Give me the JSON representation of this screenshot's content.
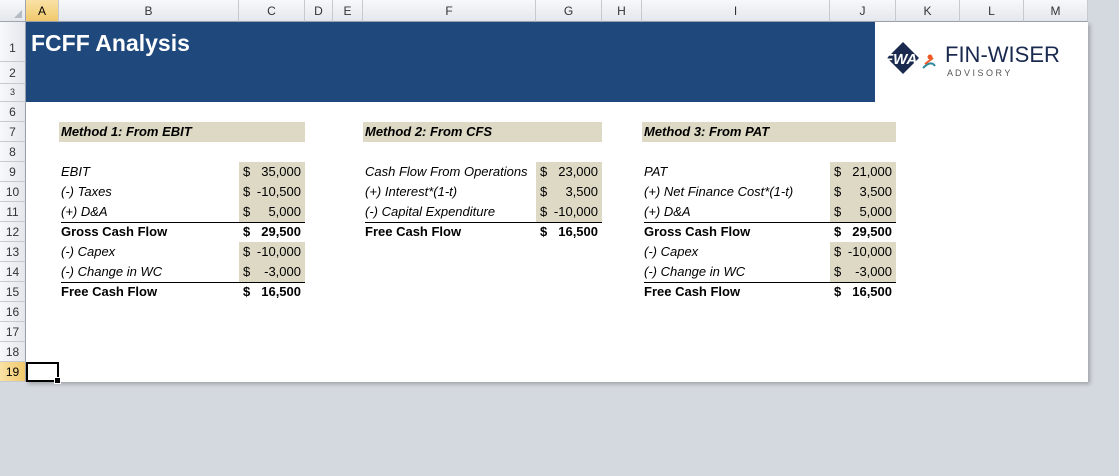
{
  "columns": [
    "A",
    "B",
    "C",
    "D",
    "E",
    "F",
    "G",
    "H",
    "I",
    "J",
    "K",
    "L",
    "M"
  ],
  "rows": [
    "1",
    "2",
    "3",
    "6",
    "7",
    "8",
    "9",
    "10",
    "11",
    "12",
    "13",
    "14",
    "15",
    "16",
    "17",
    "18",
    "19"
  ],
  "title": "FCFF Analysis",
  "logo": {
    "initials": "FWA",
    "name": "FIN-WISER",
    "sub": "A D V I S O R Y",
    "colors": {
      "navy": "#1a2a4f",
      "orange": "#f05a28",
      "teal": "#2b8a9a"
    }
  },
  "colors": {
    "banner": "#1f497d",
    "cell_fill": "#ddd9c4"
  },
  "method1": {
    "header": "Method 1: From EBIT",
    "rows": [
      {
        "label": "EBIT",
        "sym": "$",
        "value": "35,000"
      },
      {
        "label": " (-) Taxes",
        "sym": "$",
        "value": "-10,500"
      },
      {
        "label": " (+) D&A",
        "sym": "$",
        "value": "5,000"
      },
      {
        "label": "Gross Cash Flow",
        "sym": "$",
        "value": "29,500"
      },
      {
        "label": " (-) Capex",
        "sym": "$",
        "value": "-10,000"
      },
      {
        "label": " (-) Change in WC",
        "sym": "$",
        "value": "-3,000"
      },
      {
        "label": "Free Cash Flow",
        "sym": "$",
        "value": "16,500"
      }
    ]
  },
  "method2": {
    "header": "Method 2: From CFS",
    "rows": [
      {
        "label": "Cash Flow From Operations",
        "sym": "$",
        "value": "23,000"
      },
      {
        "label": " (+) Interest*(1-t)",
        "sym": "$",
        "value": "3,500"
      },
      {
        "label": " (-) Capital Expenditure",
        "sym": "$",
        "value": "-10,000"
      },
      {
        "label": "Free Cash Flow",
        "sym": "$",
        "value": "16,500"
      }
    ]
  },
  "method3": {
    "header": "Method 3: From PAT",
    "rows": [
      {
        "label": "PAT",
        "sym": "$",
        "value": "21,000"
      },
      {
        "label": " (+) Net Finance Cost*(1-t)",
        "sym": "$",
        "value": "3,500"
      },
      {
        "label": " (+) D&A",
        "sym": "$",
        "value": "5,000"
      },
      {
        "label": "Gross Cash Flow",
        "sym": "$",
        "value": "29,500"
      },
      {
        "label": " (-) Capex",
        "sym": "$",
        "value": "-10,000"
      },
      {
        "label": " (-) Change in WC",
        "sym": "$",
        "value": "-3,000"
      },
      {
        "label": "Free Cash Flow",
        "sym": "$",
        "value": "16,500"
      }
    ]
  }
}
